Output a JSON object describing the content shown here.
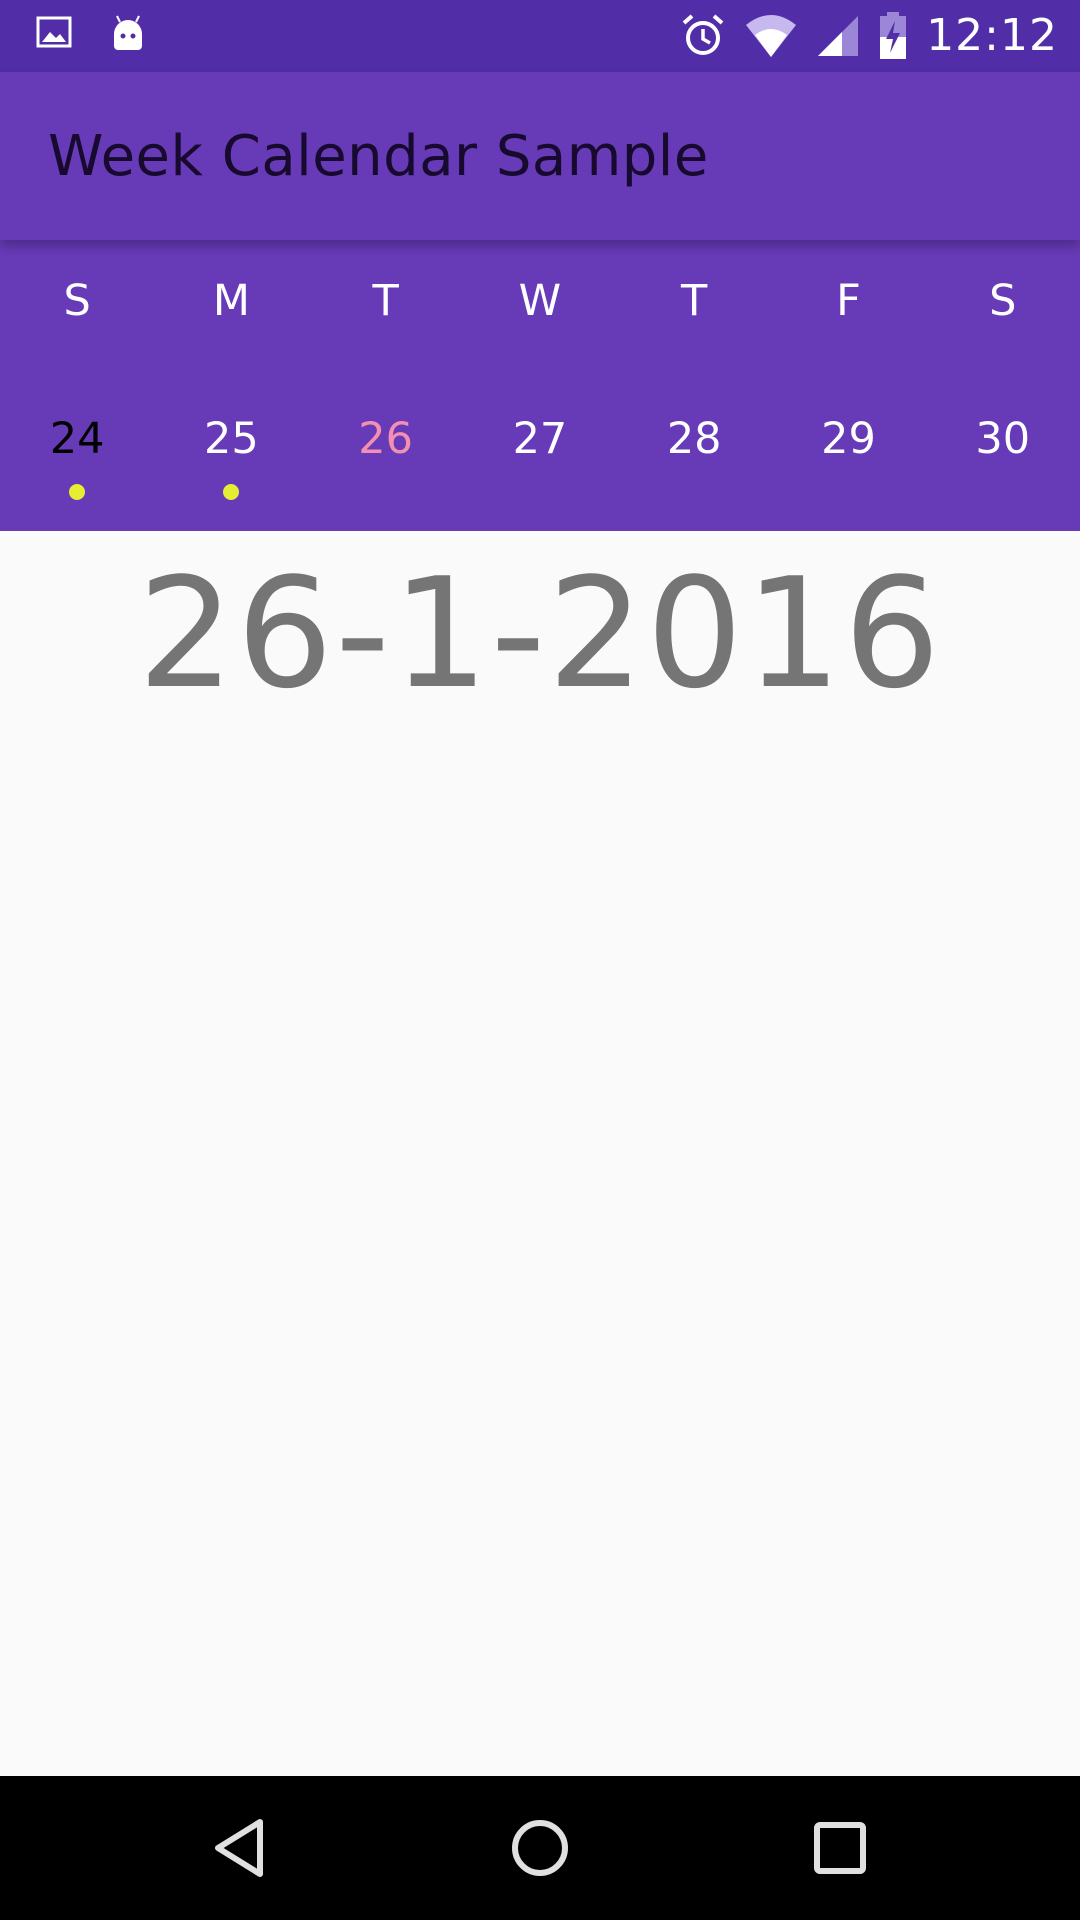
{
  "status_bar": {
    "time": "12:12",
    "left_icons": [
      "image-icon",
      "android-icon"
    ],
    "right_icons": [
      "alarm-icon",
      "wifi-icon",
      "signal-icon",
      "battery-charging-icon"
    ]
  },
  "app_bar": {
    "title": "Week Calendar Sample"
  },
  "week": {
    "weekdays": [
      "S",
      "M",
      "T",
      "W",
      "T",
      "F",
      "S"
    ],
    "dates": [
      {
        "label": "24",
        "state": "selected",
        "has_event": true
      },
      {
        "label": "25",
        "state": "normal",
        "has_event": true
      },
      {
        "label": "26",
        "state": "today",
        "has_event": false
      },
      {
        "label": "27",
        "state": "normal",
        "has_event": false
      },
      {
        "label": "28",
        "state": "normal",
        "has_event": false
      },
      {
        "label": "29",
        "state": "normal",
        "has_event": false
      },
      {
        "label": "30",
        "state": "normal",
        "has_event": false
      }
    ]
  },
  "main": {
    "selected_date": "26-1-2016"
  },
  "nav_bar": {
    "buttons": [
      "back-icon",
      "home-icon",
      "recents-icon"
    ]
  },
  "colors": {
    "status_bar": "#512da8",
    "primary": "#673ab7",
    "today": "#f48fb1",
    "event_dot": "#e6ee34",
    "date_text": "#757575"
  }
}
